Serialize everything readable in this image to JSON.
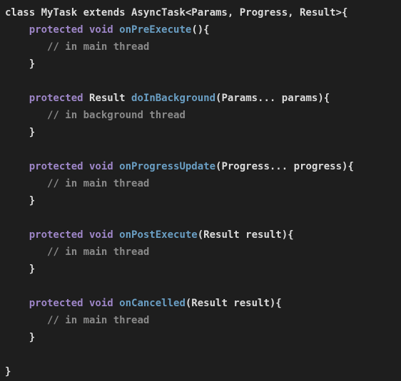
{
  "colors": {
    "background": "#1e1e1e",
    "plain": "#dcdcdc",
    "keyword": "#9e86c8",
    "function": "#6a9fc4",
    "comment": "#8a8a8a"
  },
  "lines": [
    [
      {
        "t": "class MyTask extends AsyncTask<Params, Progress, Result>{",
        "c": "plain"
      }
    ],
    [
      {
        "t": "    ",
        "c": "plain"
      },
      {
        "t": "protected void ",
        "c": "kw"
      },
      {
        "t": "onPreExecute",
        "c": "fn"
      },
      {
        "t": "(){",
        "c": "plain"
      }
    ],
    [
      {
        "t": "       ",
        "c": "plain"
      },
      {
        "t": "// in main thread",
        "c": "cm"
      }
    ],
    [
      {
        "t": "    }",
        "c": "plain"
      }
    ],
    [],
    [
      {
        "t": "    ",
        "c": "plain"
      },
      {
        "t": "protected ",
        "c": "kw"
      },
      {
        "t": "Result ",
        "c": "plain"
      },
      {
        "t": "doInBackground",
        "c": "fn"
      },
      {
        "t": "(Params... params){",
        "c": "plain"
      }
    ],
    [
      {
        "t": "       ",
        "c": "plain"
      },
      {
        "t": "// in background thread",
        "c": "cm"
      }
    ],
    [
      {
        "t": "    }",
        "c": "plain"
      }
    ],
    [],
    [
      {
        "t": "    ",
        "c": "plain"
      },
      {
        "t": "protected void ",
        "c": "kw"
      },
      {
        "t": "onProgressUpdate",
        "c": "fn"
      },
      {
        "t": "(Progress... progress){",
        "c": "plain"
      }
    ],
    [
      {
        "t": "       ",
        "c": "plain"
      },
      {
        "t": "// in main thread",
        "c": "cm"
      }
    ],
    [
      {
        "t": "    }",
        "c": "plain"
      }
    ],
    [],
    [
      {
        "t": "    ",
        "c": "plain"
      },
      {
        "t": "protected void ",
        "c": "kw"
      },
      {
        "t": "onPostExecute",
        "c": "fn"
      },
      {
        "t": "(Result result){",
        "c": "plain"
      }
    ],
    [
      {
        "t": "       ",
        "c": "plain"
      },
      {
        "t": "// in main thread",
        "c": "cm"
      }
    ],
    [
      {
        "t": "    }",
        "c": "plain"
      }
    ],
    [],
    [
      {
        "t": "    ",
        "c": "plain"
      },
      {
        "t": "protected void ",
        "c": "kw"
      },
      {
        "t": "onCancelled",
        "c": "fn"
      },
      {
        "t": "(Result result){",
        "c": "plain"
      }
    ],
    [
      {
        "t": "       ",
        "c": "plain"
      },
      {
        "t": "// in main thread",
        "c": "cm"
      }
    ],
    [
      {
        "t": "    }",
        "c": "plain"
      }
    ],
    [],
    [
      {
        "t": "}",
        "c": "plain"
      }
    ]
  ]
}
